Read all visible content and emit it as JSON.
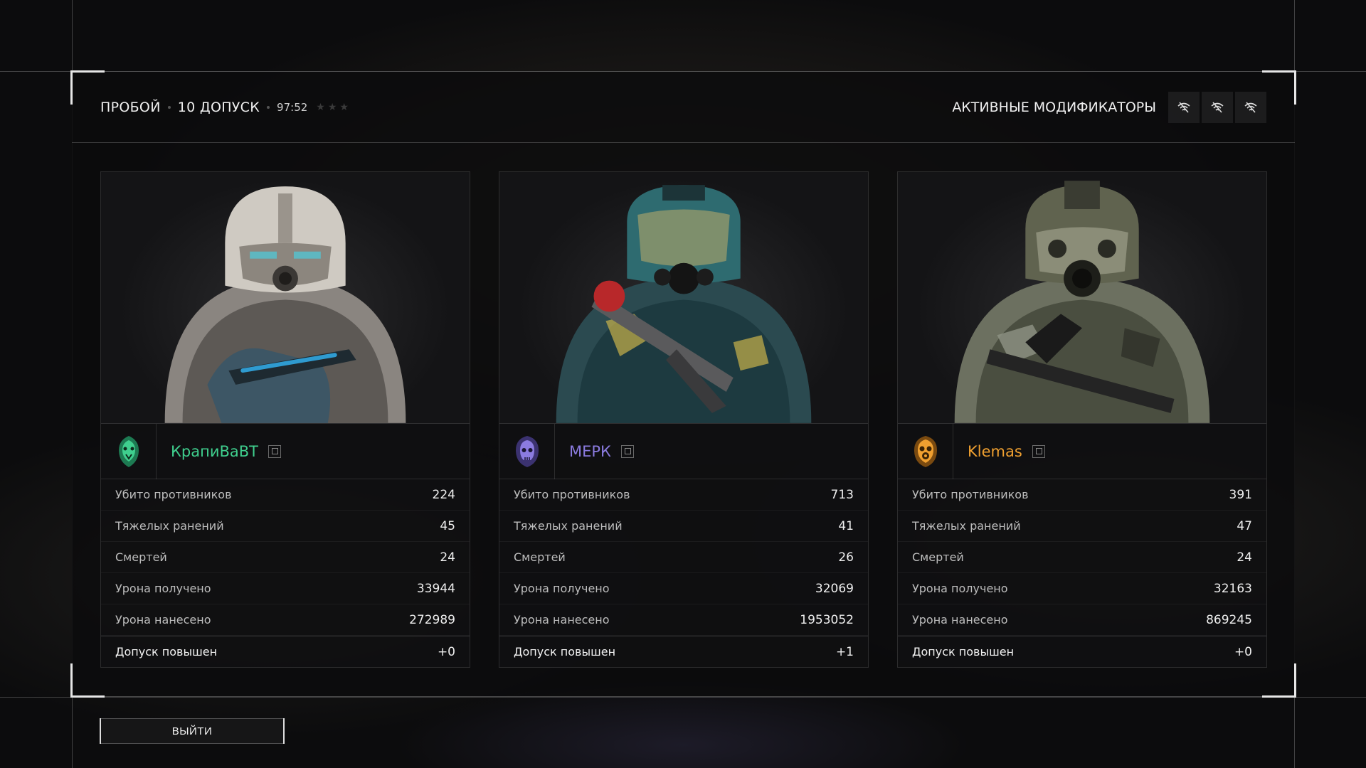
{
  "header": {
    "mode": "ПРОБОЙ",
    "access": "10 ДОПУСК",
    "time": "97:52",
    "stars": 3,
    "mods_label": "АКТИВНЫЕ МОДИФИКАТОРЫ",
    "mod_icons": [
      "wifi-off-icon",
      "wifi-off-icon",
      "wifi-off-icon"
    ]
  },
  "players": [
    {
      "name": "КрапиВаВТ",
      "name_color": "#3fcf8e",
      "emblem": "cobra-emblem",
      "stats": [
        {
          "label": "Убито противников",
          "value": "224"
        },
        {
          "label": "Тяжелых ранений",
          "value": "45"
        },
        {
          "label": "Смертей",
          "value": "24"
        },
        {
          "label": "Урона получено",
          "value": "33944"
        },
        {
          "label": "Урона нанесено",
          "value": "272989"
        },
        {
          "label": "Допуск повышен",
          "value": "+0"
        }
      ]
    },
    {
      "name": "МЕРК",
      "name_color": "#8b7be0",
      "emblem": "skull-emblem",
      "stats": [
        {
          "label": "Убито противников",
          "value": "713"
        },
        {
          "label": "Тяжелых ранений",
          "value": "41"
        },
        {
          "label": "Смертей",
          "value": "26"
        },
        {
          "label": "Урона получено",
          "value": "32069"
        },
        {
          "label": "Урона нанесено",
          "value": "1953052"
        },
        {
          "label": "Допуск повышен",
          "value": "+1"
        }
      ]
    },
    {
      "name": "Klemas",
      "name_color": "#f0a030",
      "emblem": "gasmask-emblem",
      "stats": [
        {
          "label": "Убито противников",
          "value": "391"
        },
        {
          "label": "Тяжелых ранений",
          "value": "47"
        },
        {
          "label": "Смертей",
          "value": "24"
        },
        {
          "label": "Урона получено",
          "value": "32163"
        },
        {
          "label": "Урона нанесено",
          "value": "869245"
        },
        {
          "label": "Допуск повышен",
          "value": "+0"
        }
      ]
    }
  ],
  "exit_label": "ВЫЙТИ"
}
